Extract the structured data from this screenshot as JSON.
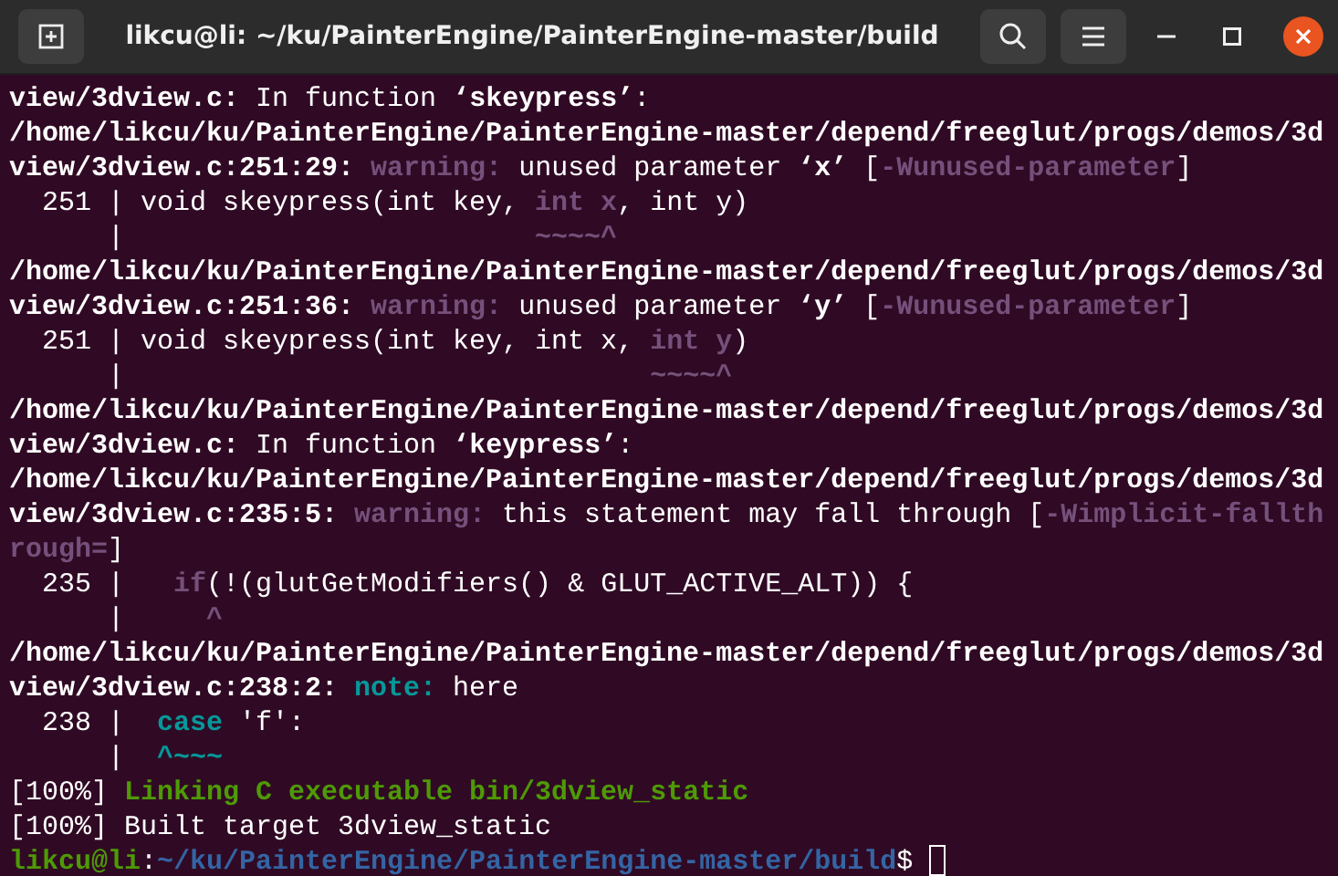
{
  "window": {
    "title": "likcu@li: ~/ku/PainterEngine/PainterEngine-master/build"
  },
  "terminal": {
    "cursor": true,
    "lines": [
      {
        "segments": [
          {
            "text": "view/3dview.c:",
            "kind": "bold"
          },
          {
            "text": " In function ",
            "kind": "normal"
          },
          {
            "text": "‘skeypress’",
            "kind": "bold"
          },
          {
            "text": ":",
            "kind": "normal"
          }
        ]
      },
      {
        "segments": [
          {
            "text": "/home/likcu/ku/PainterEngine/PainterEngine-master/depend/freeglut/progs/demos/3d",
            "kind": "bold"
          }
        ]
      },
      {
        "segments": [
          {
            "text": "view/3dview.c:251:29: ",
            "kind": "bold"
          },
          {
            "text": "warning:",
            "kind": "warning"
          },
          {
            "text": " unused parameter ",
            "kind": "normal"
          },
          {
            "text": "‘x’",
            "kind": "bold"
          },
          {
            "text": " [",
            "kind": "normal"
          },
          {
            "text": "-Wunused-parameter",
            "kind": "warning"
          },
          {
            "text": "]",
            "kind": "normal"
          }
        ]
      },
      {
        "segments": [
          {
            "text": "  251 | void skeypress(int key, ",
            "kind": "normal"
          },
          {
            "text": "int x",
            "kind": "warning"
          },
          {
            "text": ", int y)",
            "kind": "normal"
          }
        ]
      },
      {
        "segments": [
          {
            "text": "      |                         ",
            "kind": "normal"
          },
          {
            "text": "~~~~^",
            "kind": "warning"
          }
        ]
      },
      {
        "segments": [
          {
            "text": "/home/likcu/ku/PainterEngine/PainterEngine-master/depend/freeglut/progs/demos/3d",
            "kind": "bold"
          }
        ]
      },
      {
        "segments": [
          {
            "text": "view/3dview.c:251:36: ",
            "kind": "bold"
          },
          {
            "text": "warning:",
            "kind": "warning"
          },
          {
            "text": " unused parameter ",
            "kind": "normal"
          },
          {
            "text": "‘y’",
            "kind": "bold"
          },
          {
            "text": " [",
            "kind": "normal"
          },
          {
            "text": "-Wunused-parameter",
            "kind": "warning"
          },
          {
            "text": "]",
            "kind": "normal"
          }
        ]
      },
      {
        "segments": [
          {
            "text": "  251 | void skeypress(int key, int x, ",
            "kind": "normal"
          },
          {
            "text": "int y",
            "kind": "warning"
          },
          {
            "text": ")",
            "kind": "normal"
          }
        ]
      },
      {
        "segments": [
          {
            "text": "      |                                ",
            "kind": "normal"
          },
          {
            "text": "~~~~^",
            "kind": "warning"
          }
        ]
      },
      {
        "segments": [
          {
            "text": "/home/likcu/ku/PainterEngine/PainterEngine-master/depend/freeglut/progs/demos/3d",
            "kind": "bold"
          }
        ]
      },
      {
        "segments": [
          {
            "text": "view/3dview.c:",
            "kind": "bold"
          },
          {
            "text": " In function ",
            "kind": "normal"
          },
          {
            "text": "‘keypress’",
            "kind": "bold"
          },
          {
            "text": ":",
            "kind": "normal"
          }
        ]
      },
      {
        "segments": [
          {
            "text": "/home/likcu/ku/PainterEngine/PainterEngine-master/depend/freeglut/progs/demos/3d",
            "kind": "bold"
          }
        ]
      },
      {
        "segments": [
          {
            "text": "view/3dview.c:235:5: ",
            "kind": "bold"
          },
          {
            "text": "warning:",
            "kind": "warning"
          },
          {
            "text": " this statement may fall through [",
            "kind": "normal"
          },
          {
            "text": "-Wimplicit-fallth",
            "kind": "warning"
          }
        ]
      },
      {
        "segments": [
          {
            "text": "rough=",
            "kind": "warning"
          },
          {
            "text": "]",
            "kind": "normal"
          }
        ]
      },
      {
        "segments": [
          {
            "text": "  235 |   ",
            "kind": "normal"
          },
          {
            "text": "if",
            "kind": "warning"
          },
          {
            "text": "(!(glutGetModifiers() & GLUT_ACTIVE_ALT)) {",
            "kind": "normal"
          }
        ]
      },
      {
        "segments": [
          {
            "text": "      |     ",
            "kind": "normal"
          },
          {
            "text": "^",
            "kind": "warning"
          }
        ]
      },
      {
        "segments": [
          {
            "text": "/home/likcu/ku/PainterEngine/PainterEngine-master/depend/freeglut/progs/demos/3d",
            "kind": "bold"
          }
        ]
      },
      {
        "segments": [
          {
            "text": "view/3dview.c:238:2: ",
            "kind": "bold"
          },
          {
            "text": "note:",
            "kind": "note"
          },
          {
            "text": " here",
            "kind": "normal"
          }
        ]
      },
      {
        "segments": [
          {
            "text": "  238 |  ",
            "kind": "normal"
          },
          {
            "text": "case",
            "kind": "note"
          },
          {
            "text": " 'f':",
            "kind": "normal"
          }
        ]
      },
      {
        "segments": [
          {
            "text": "      |  ",
            "kind": "normal"
          },
          {
            "text": "^~~~",
            "kind": "note"
          }
        ]
      },
      {
        "segments": [
          {
            "text": "[100%] ",
            "kind": "normal"
          },
          {
            "text": "Linking C executable bin/3dview_static",
            "kind": "success"
          }
        ]
      },
      {
        "segments": [
          {
            "text": "[100%] Built target 3dview_static",
            "kind": "normal"
          }
        ]
      },
      {
        "segments": [
          {
            "text": "likcu@li",
            "kind": "prompt-user"
          },
          {
            "text": ":",
            "kind": "normal"
          },
          {
            "text": "~/ku/PainterEngine/PainterEngine-master/build",
            "kind": "prompt-path"
          },
          {
            "text": "$ ",
            "kind": "normal"
          }
        ]
      }
    ]
  }
}
